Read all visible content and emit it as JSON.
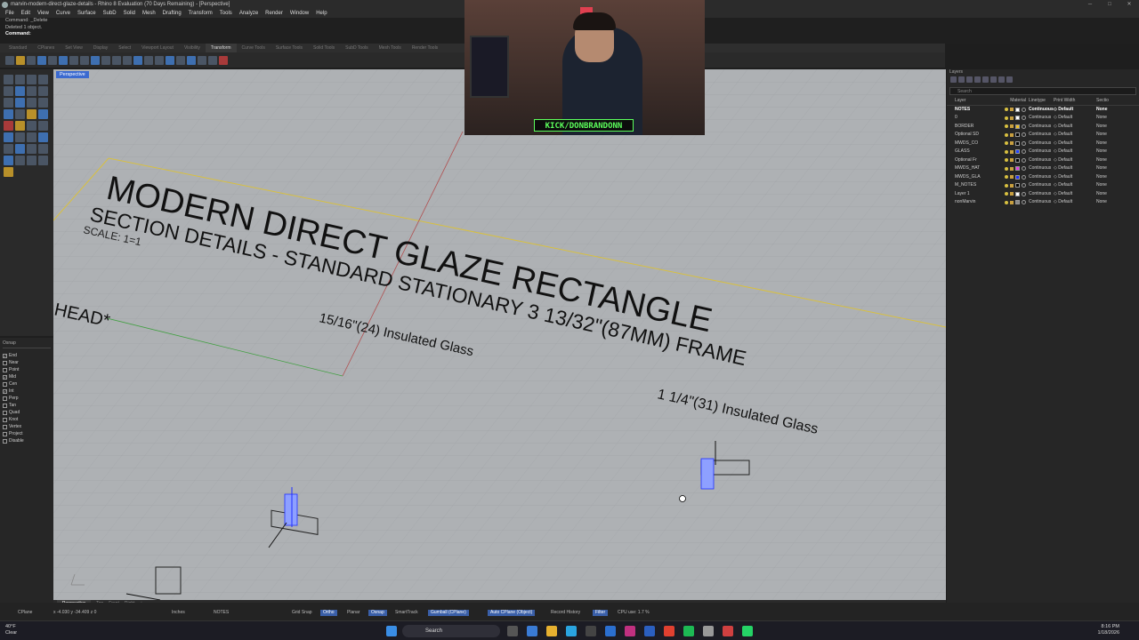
{
  "window": {
    "title": "marvin-modern-direct-glaze-details - Rhino 8 Evaluation (70 Days Remaining) - [Perspective]"
  },
  "menu": [
    "File",
    "Edit",
    "View",
    "Curve",
    "Surface",
    "SubD",
    "Solid",
    "Mesh",
    "Drafting",
    "Transform",
    "Tools",
    "Analyze",
    "Render",
    "Window",
    "Help"
  ],
  "command": {
    "history1": "Command: _Delete",
    "history2": "Deleted 1 object.",
    "prompt": "Command:"
  },
  "toolbar_tabs": [
    "Standard",
    "CPlanes",
    "Set View",
    "Display",
    "Select",
    "Viewport Layout",
    "Visibility",
    "Transform",
    "Curve Tools",
    "Surface Tools",
    "Solid Tools",
    "SubD Tools",
    "Mesh Tools",
    "Render Tools"
  ],
  "active_tab": "Transform",
  "viewport": {
    "name": "Perspective",
    "texts": {
      "title": "MODERN DIRECT GLAZE RECTANGLE",
      "subtitle": "SECTION DETAILS - STANDARD STATIONARY 3 13/32\"(87MM) FRAME",
      "scale": "SCALE: 1=1",
      "head": "HEAD*",
      "glass1": "15/16\"(24) Insulated Glass",
      "glass2": "1 1/4\"(31) Insulated Glass"
    },
    "tabs": [
      "Perspective",
      "Top",
      "Front",
      "Right"
    ]
  },
  "stream": {
    "badge": "KICK/DONBRANDONN"
  },
  "osnap": {
    "title": "Osnap",
    "items": [
      {
        "label": "End",
        "checked": true
      },
      {
        "label": "Near",
        "checked": false
      },
      {
        "label": "Point",
        "checked": false
      },
      {
        "label": "Mid",
        "checked": true
      },
      {
        "label": "Cen",
        "checked": false
      },
      {
        "label": "Int",
        "checked": true
      },
      {
        "label": "Perp",
        "checked": false
      },
      {
        "label": "Tan",
        "checked": false
      },
      {
        "label": "Quad",
        "checked": false
      },
      {
        "label": "Knot",
        "checked": false
      },
      {
        "label": "Vertex",
        "checked": false
      },
      {
        "label": "Project",
        "checked": false
      },
      {
        "label": "Disable",
        "checked": false
      }
    ]
  },
  "layers": {
    "panel_title": "Layers",
    "search_placeholder": "Search",
    "columns": {
      "layer": "Layer",
      "material": "Material",
      "linetype": "Linetype",
      "print_width": "Print Width",
      "section": "Sectio"
    },
    "rows": [
      {
        "name": "NOTES",
        "color": "#ffffff",
        "linetype": "Continuous",
        "print_width": "Default",
        "section": "None",
        "current": true
      },
      {
        "name": "0",
        "color": "#ffffff",
        "linetype": "Continuous",
        "print_width": "Default",
        "section": "None"
      },
      {
        "name": "BORDER",
        "color": "#f0c020",
        "linetype": "Continuous",
        "print_width": "Default",
        "section": "None"
      },
      {
        "name": "Optional SD",
        "color": "#000000",
        "linetype": "Continuous",
        "print_width": "Default",
        "section": "None"
      },
      {
        "name": "MWDS_CO",
        "color": "#000000",
        "linetype": "Continuous",
        "print_width": "Default",
        "section": "None"
      },
      {
        "name": "GLASS",
        "color": "#2040ff",
        "linetype": "Continuous",
        "print_width": "Default",
        "section": "None"
      },
      {
        "name": "Optional Fr",
        "color": "#000000",
        "linetype": "Continuous",
        "print_width": "Default",
        "section": "None"
      },
      {
        "name": "MWDS_HAT",
        "color": "#e040e0",
        "linetype": "Continuous",
        "print_width": "Default",
        "section": "None"
      },
      {
        "name": "MWDS_GLA",
        "color": "#2030ff",
        "linetype": "Continuous",
        "print_width": "Default",
        "section": "None"
      },
      {
        "name": "M_NOTES",
        "color": "#000000",
        "linetype": "Continuous",
        "print_width": "Default",
        "section": "None"
      },
      {
        "name": "Layer 1",
        "color": "#ffffff",
        "linetype": "Continuous",
        "print_width": "Default",
        "section": "None"
      },
      {
        "name": "nonMarvin",
        "color": "#888888",
        "linetype": "Continuous",
        "print_width": "Default",
        "section": "None"
      }
    ]
  },
  "statusbar": {
    "cplane": "CPlane",
    "coords": "x -4.030   y -34.409   z 0",
    "units": "Inches",
    "layer": "NOTES",
    "grid_snap": "Grid Snap",
    "ortho": "Ortho",
    "planar": "Planar",
    "osnap": "Osnap",
    "smarttrack": "SmartTrack",
    "gumball": "Gumball (CPlane)",
    "autocplane": "Auto CPlane (Object)",
    "record": "Record History",
    "filter": "Filter",
    "cpu": "CPU use: 1.7 %"
  },
  "taskbar": {
    "weather_temp": "40°F",
    "weather_cond": "Clear",
    "search": "Search",
    "time": "8:16 PM",
    "date": "1/18/2026"
  }
}
